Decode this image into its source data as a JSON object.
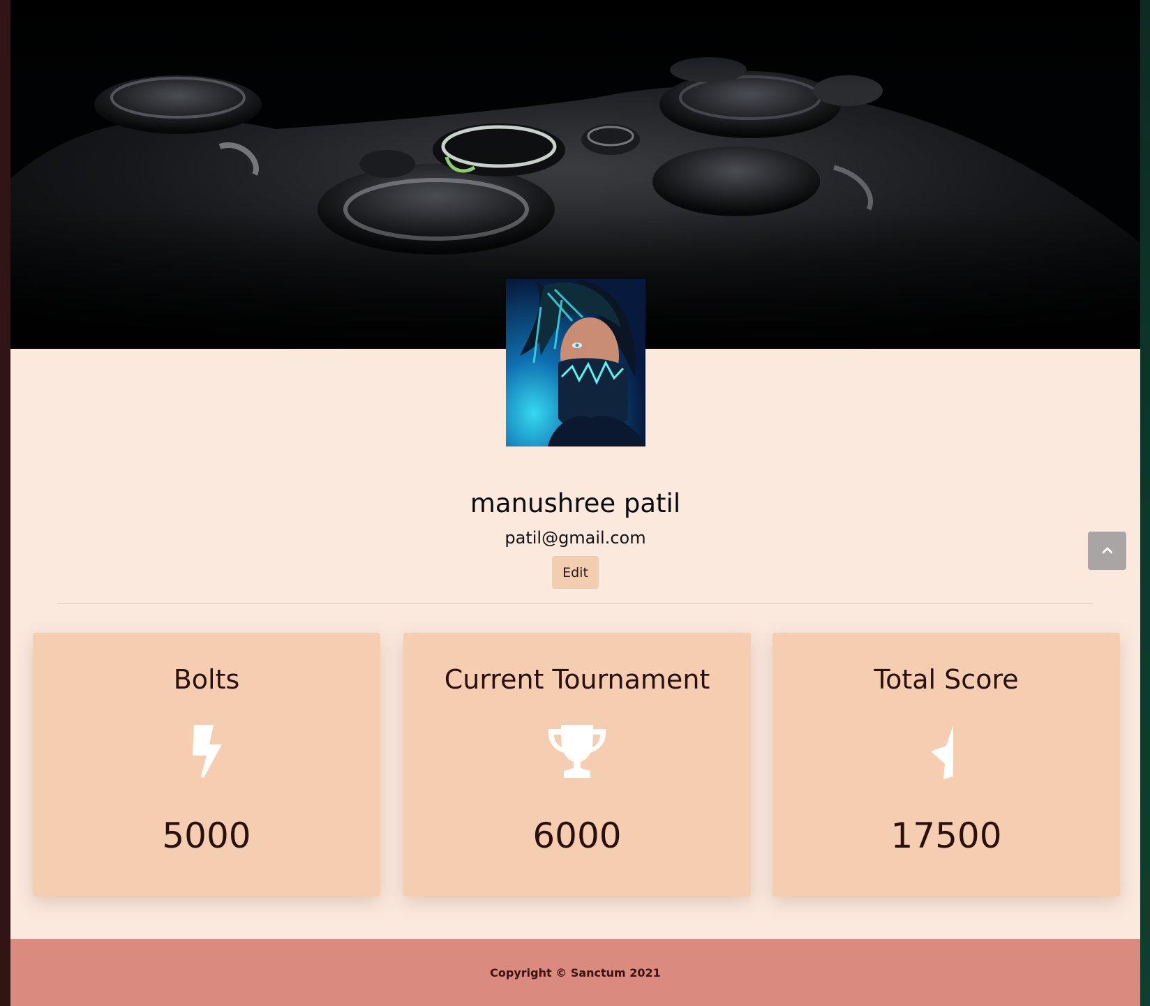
{
  "profile": {
    "name": "manushree patil",
    "email": "patil@gmail.com",
    "edit_label": "Edit"
  },
  "stats": [
    {
      "title": "Bolts",
      "icon": "bolt-icon",
      "value": "5000"
    },
    {
      "title": "Current Tournament",
      "icon": "trophy-icon",
      "value": "6000"
    },
    {
      "title": "Total Score",
      "icon": "star-half-icon",
      "value": "17500"
    }
  ],
  "footer": {
    "copyright": "Copyright © Sanctum 2021"
  },
  "scroll_top": {
    "icon": "chevron-up-icon"
  },
  "colors": {
    "page_background": "#fbe9de",
    "card_background": "#f5cdb0",
    "button_background": "#f3cdb0",
    "footer_background": "#da8a7f",
    "text_dark": "#2a0f0c"
  }
}
